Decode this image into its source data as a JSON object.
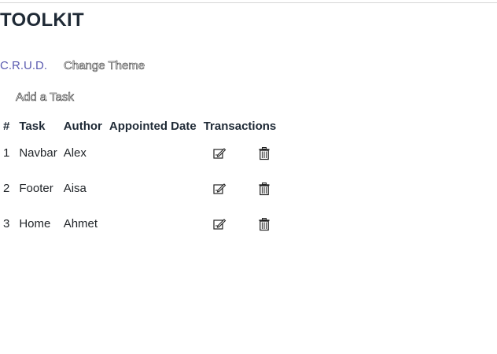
{
  "app": {
    "brand": "TOOLKIT"
  },
  "nav": {
    "crud_link": "C.R.U.D.",
    "change_theme_label": "Change Theme"
  },
  "toolbar": {
    "add_task_label": "Add a Task"
  },
  "table": {
    "headers": [
      "#",
      "Task",
      "Author",
      "Appointed Date",
      "Transactions"
    ],
    "rows": [
      {
        "num": "1",
        "task": "Navbar",
        "author": "Alex",
        "date": "",
        "edit_icon": "edit-icon",
        "delete_icon": "trash-icon"
      },
      {
        "num": "2",
        "task": "Footer",
        "author": "Aisa",
        "date": "",
        "edit_icon": "edit-icon",
        "delete_icon": "trash-icon"
      },
      {
        "num": "3",
        "task": "Home",
        "author": "Ahmet",
        "date": "",
        "edit_icon": "edit-icon",
        "delete_icon": "trash-icon"
      }
    ]
  },
  "colors": {
    "link": "#5b5bb0",
    "text": "#212529",
    "heading": "#1f2a36"
  }
}
